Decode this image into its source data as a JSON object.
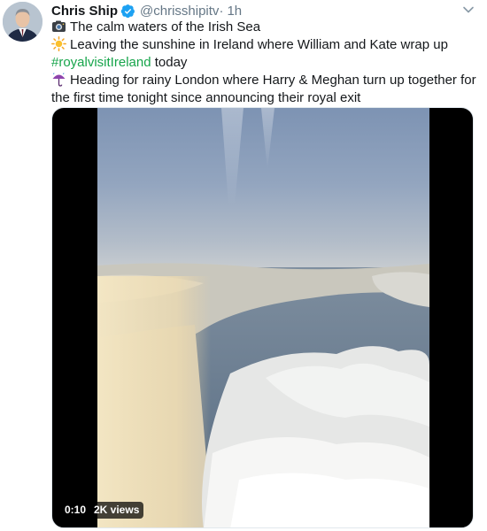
{
  "author": {
    "display_name": "Chris Ship",
    "handle": "@chrisshipitv",
    "separator": "·",
    "time": "1h",
    "avatar_icon": "person-portrait",
    "verified_icon": "verified-badge-icon"
  },
  "tweet": {
    "line1": "The calm waters of the Irish Sea",
    "line2": "Leaving the sunshine in Ireland where William and Kate wrap up",
    "hashtag": "#royalvisitIreland",
    "line3_rest": " today",
    "line4": "Heading for rainy London where Harry & Meghan turn up together for",
    "line5": "the first time tonight since announcing their royal exit"
  },
  "icons": {
    "camera": "camera-icon",
    "sun": "sun-icon",
    "umbrella": "umbrella-rain-icon",
    "caret": "chevron-down-icon"
  },
  "colors": {
    "hashtag": "#17a54b",
    "verified": "#1da1f2",
    "muted": "#657786"
  },
  "media": {
    "duration": "0:10",
    "views": "2K views"
  }
}
